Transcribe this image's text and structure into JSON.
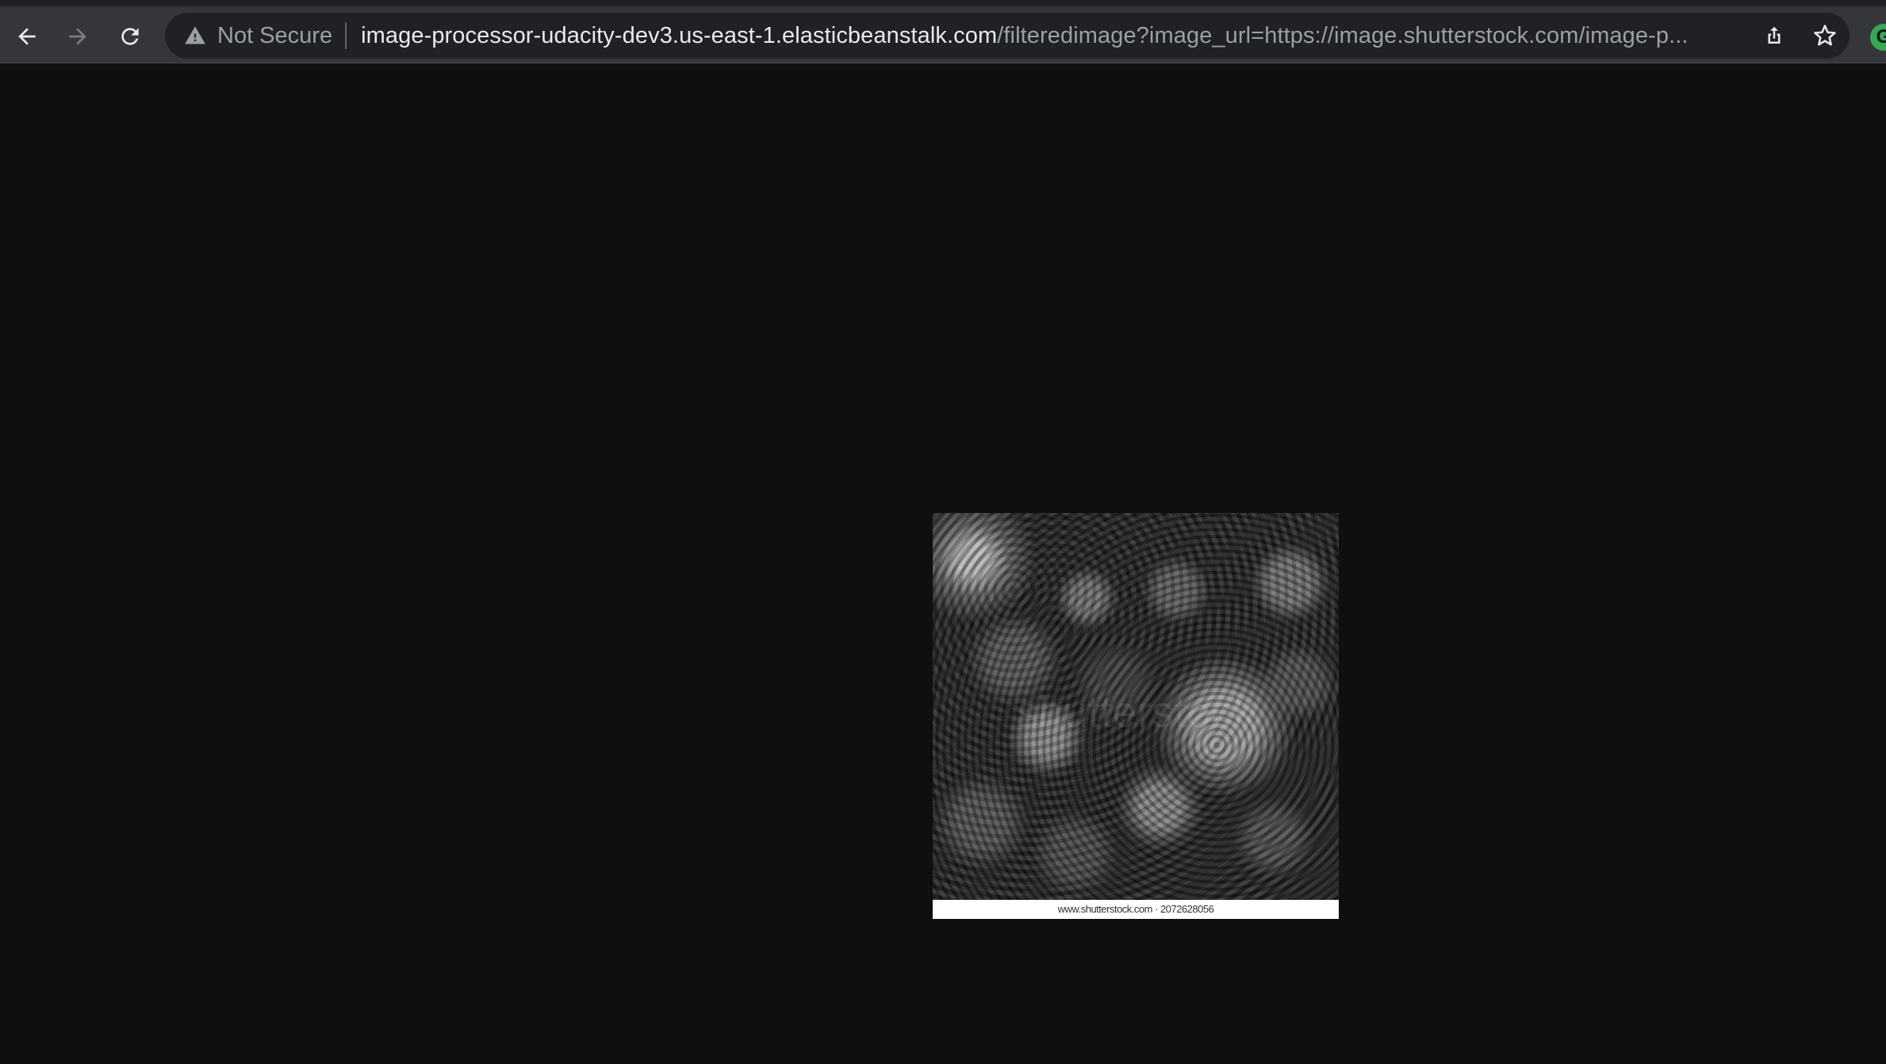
{
  "browser": {
    "security_label": "Not Secure",
    "url_host": "image-processor-udacity-dev3.us-east-1.elasticbeanstalk.com",
    "url_path": "/filteredimage?image_url=https://image.shutterstock.com/image-p..."
  },
  "page": {
    "image_watermark": "shutterstock",
    "image_caption": "www.shutterstock.com · 2072628056"
  },
  "colors": {
    "page_background": "#0f0f0f",
    "toolbar_background": "#35363a",
    "omnibox_background": "#202124",
    "extension_accent": "#34a853"
  }
}
